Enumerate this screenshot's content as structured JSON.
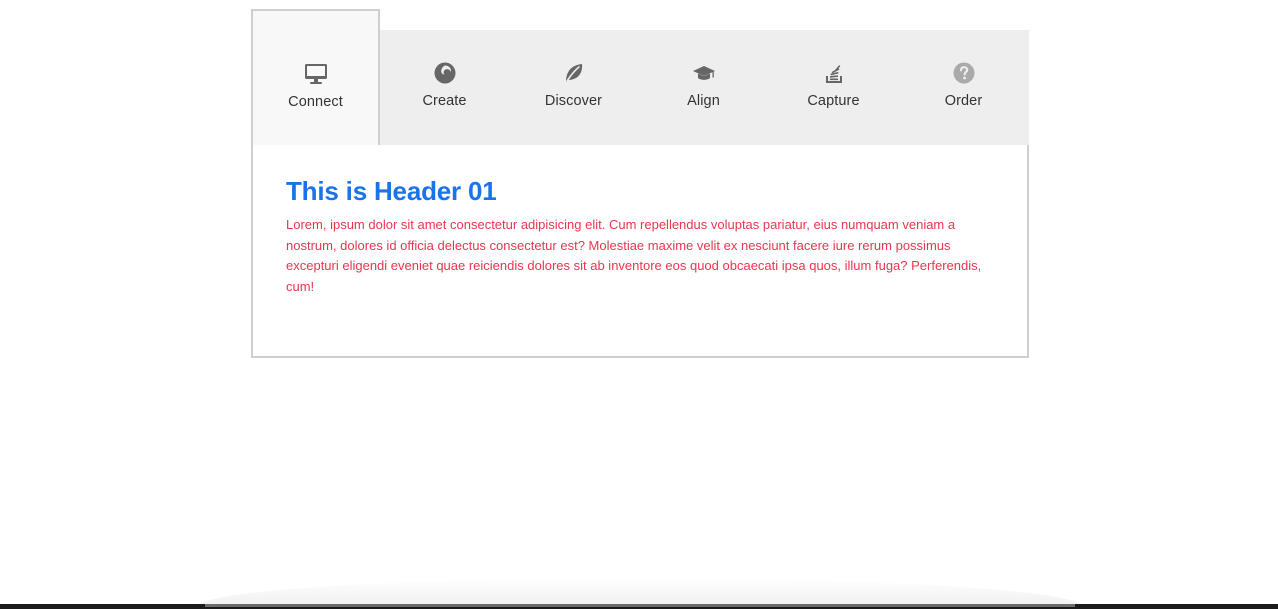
{
  "tabs": [
    {
      "label": "Connect",
      "icon": "monitor-icon",
      "active": true
    },
    {
      "label": "Create",
      "icon": "firefox-icon",
      "active": false
    },
    {
      "label": "Discover",
      "icon": "leaf-icon",
      "active": false
    },
    {
      "label": "Align",
      "icon": "graduation-cap-icon",
      "active": false
    },
    {
      "label": "Capture",
      "icon": "stack-icon",
      "active": false
    },
    {
      "label": "Order",
      "icon": "question-icon",
      "active": false
    }
  ],
  "panel": {
    "title": "This is Header 01",
    "text": "Lorem, ipsum dolor sit amet consectetur adipisicing elit. Cum repellendus voluptas pariatur, eius numquam veniam a nostrum, dolores id officia delectus consectetur est? Molestiae maxime velit ex nesciunt facere iure rerum possimus excepturi eligendi eveniet quae reiciendis dolores sit ab inventore eos quod obcaecati ipsa quos, illum fuga? Perferendis, cum!"
  },
  "colors": {
    "title": "#1a73e8",
    "text": "#e8364f",
    "tab_bar": "#eeeeee",
    "icon": "#666666"
  }
}
